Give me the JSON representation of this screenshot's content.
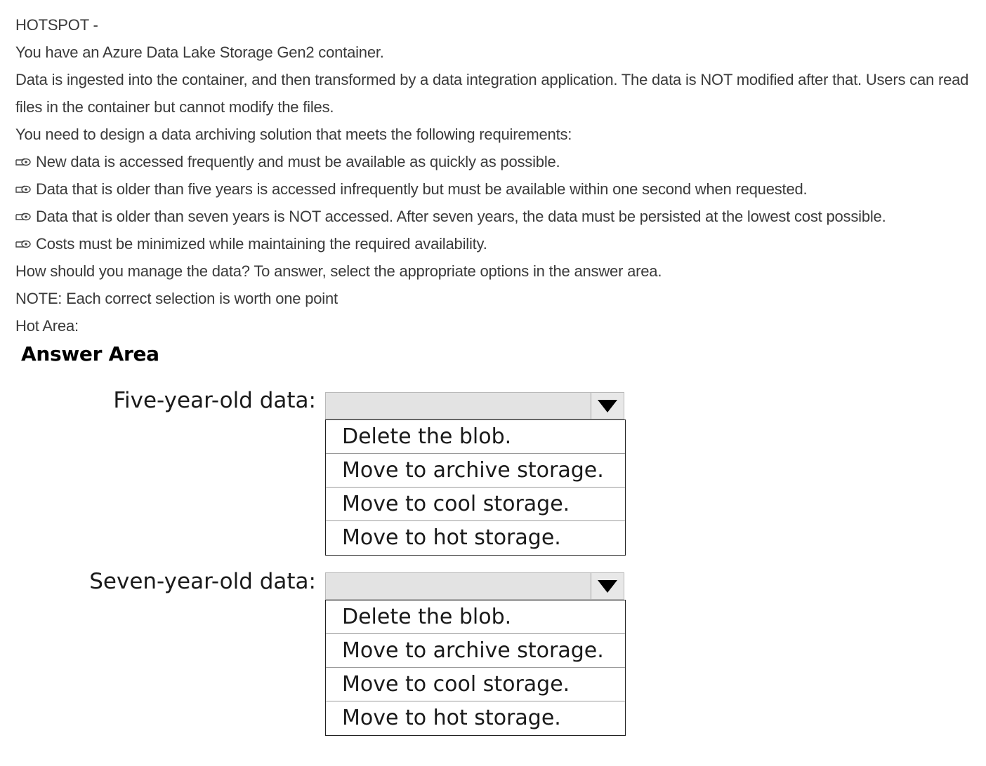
{
  "question": {
    "heading": "HOTSPOT -",
    "intro": "You have an Azure Data Lake Storage Gen2 container.",
    "description": "Data is ingested into the container, and then transformed by a data integration application. The data is NOT modified after that. Users can read files in the container but cannot modify the files.",
    "task": "You need to design a data archiving solution that meets the following requirements:",
    "requirements": [
      "New data is accessed frequently and must be available as quickly as possible.",
      "Data that is older than five years is accessed infrequently but must be available within one second when requested.",
      "Data that is older than seven years is NOT accessed. After seven years, the data must be persisted at the lowest cost possible.",
      "Costs must be minimized while maintaining the required availability."
    ],
    "prompt": "How should you manage the data? To answer, select the appropriate options in the answer area.",
    "note": "NOTE: Each correct selection is worth one point",
    "hot_area": "Hot Area:"
  },
  "answer_area": {
    "title": "Answer Area",
    "fields": [
      {
        "label": "Five-year-old data:",
        "selected": "",
        "options": [
          "Delete the blob.",
          "Move to archive storage.",
          "Move to cool storage.",
          "Move to hot storage."
        ]
      },
      {
        "label": "Seven-year-old data:",
        "selected": "",
        "options": [
          "Delete the blob.",
          "Move to archive storage.",
          "Move to cool storage.",
          "Move to hot storage."
        ]
      }
    ]
  },
  "icons": {
    "bullet": "pointing-hand-icon",
    "dropdown": "triangle-down-icon"
  }
}
